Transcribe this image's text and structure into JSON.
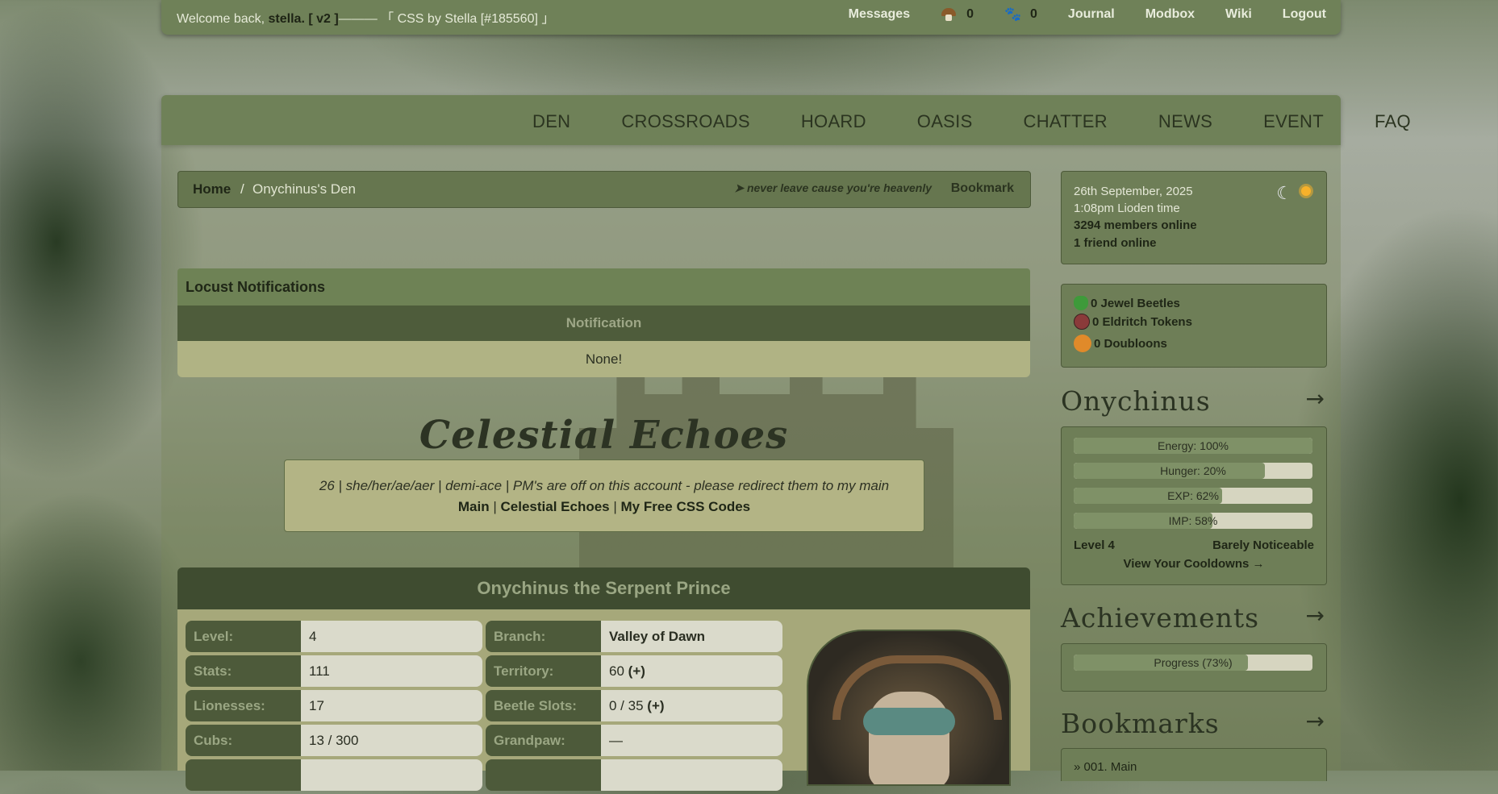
{
  "topbar": {
    "welcome_prefix": "Welcome back, ",
    "username": "stella. [ v2 ]",
    "css_credit": "——— 「 CSS by Stella [#185560] 」",
    "messages": "Messages",
    "mushroom_count": "0",
    "paw_count": "0",
    "journal": "Journal",
    "modbox": "Modbox",
    "wiki": "Wiki",
    "logout": "Logout"
  },
  "nav": [
    "DEN",
    "CROSSROADS",
    "HOARD",
    "OASIS",
    "CHATTER",
    "NEWS",
    "EVENT",
    "FAQ"
  ],
  "breadcrumb": {
    "home": "Home",
    "separator": "/",
    "current": "Onychinus's Den",
    "motto": "➤ never leave cause you're heavenly",
    "bookmark": "Bookmark"
  },
  "notifications": {
    "title": "Locust Notifications",
    "column": "Notification",
    "empty": "None!"
  },
  "profile": {
    "title": "Celestial Echoes",
    "bio": "26 | she/her/ae/aer | demi-ace | PM's are off on this account - please redirect them to my main",
    "links": [
      "Main",
      "Celestial Echoes",
      "My Free CSS Codes"
    ],
    "link_sep": "|",
    "lion_name": "Onychinus the Serpent Prince",
    "left_rows": [
      {
        "k": "Level:",
        "v": "4"
      },
      {
        "k": "Stats:",
        "v": "111"
      },
      {
        "k": "Lionesses:",
        "v": "17"
      },
      {
        "k": "Cubs:",
        "v": "13 / 300"
      }
    ],
    "right_rows": [
      {
        "k": "Branch:",
        "v": "Valley of Dawn"
      },
      {
        "k": "Territory:",
        "v": "60",
        "plus": "(+)"
      },
      {
        "k": "Beetle Slots:",
        "v": "0 / 35",
        "plus": "(+)"
      },
      {
        "k": "Grandpaw:",
        "v": "—"
      }
    ]
  },
  "sidebar": {
    "date": "26th September, 2025",
    "time": "1:08pm Lioden time",
    "members_online": "3294 members online",
    "friends_online": "1 friend online",
    "moon_icon": "☾",
    "currencies": [
      {
        "label": "0 Jewel Beetles",
        "icon": "jewel-beetle-icon",
        "color": "#3e9a3a"
      },
      {
        "label": "0 Eldritch Tokens",
        "icon": "eldritch-token-icon",
        "color": "#8a3a3a"
      },
      {
        "label": "0 Doubloons",
        "icon": "doubloon-icon",
        "color": "#e08a2a"
      }
    ],
    "lion_section": "Onychinus",
    "arrow": "→",
    "bars": [
      {
        "label": "Energy: 100%",
        "value": 1.0
      },
      {
        "label": "Hunger: 20%",
        "value": 0.8
      },
      {
        "label": "EXP: 62%",
        "value": 0.62
      },
      {
        "label": "IMP: 58%",
        "value": 0.58
      }
    ],
    "level": "Level 4",
    "notice": "Barely Noticeable",
    "cooldowns": "View Your Cooldowns →",
    "achievements": "Achievements",
    "achievement_bar": {
      "label": "Progress (73%)",
      "value": 0.73
    },
    "bookmarks": "Bookmarks",
    "bookmark_item": "» 001. Main"
  }
}
